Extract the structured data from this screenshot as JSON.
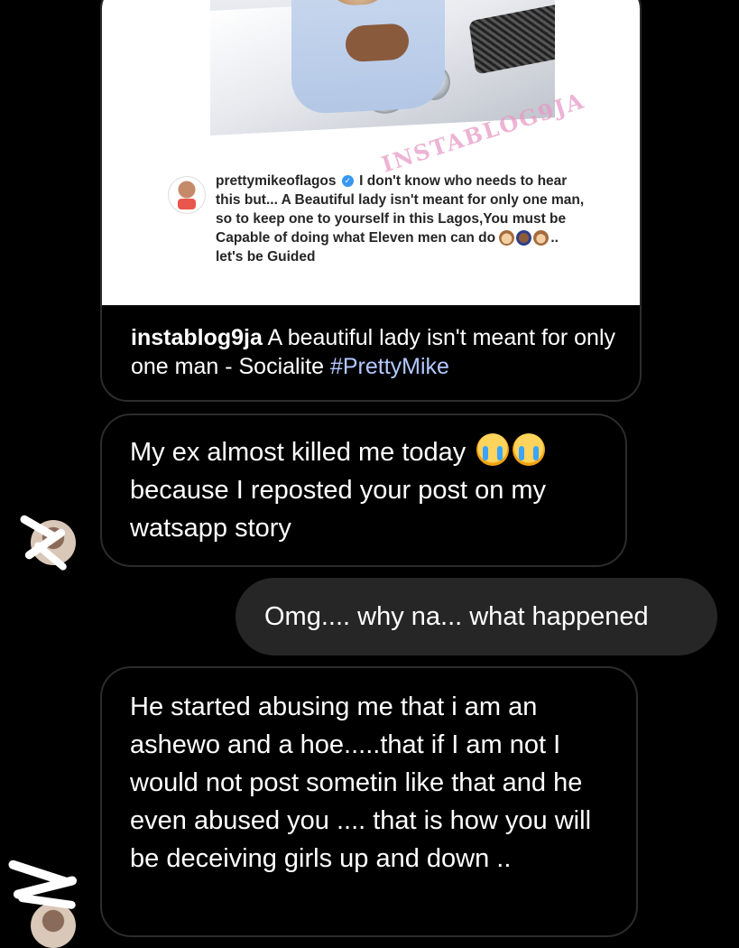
{
  "post": {
    "watermark": "INSTABLOG9JA",
    "caption_username": "prettymikeoflagos",
    "caption_text": "I don't know who needs to hear this but... A Beautiful lady isn't meant for only one man, so to keep one to yourself in this Lagos,You must be Capable of doing what Eleven men can do",
    "caption_tail": "..",
    "caption_end": "let's be Guided",
    "footer_account": "instablog9ja",
    "footer_text": "A beautiful lady isn't meant for only one man - Socialite",
    "footer_hashtag": "#PrettyMike"
  },
  "messages": [
    {
      "direction": "incoming",
      "text": "My ex almost killed me today",
      "emoji": [
        "loudly-crying-face",
        "loudly-crying-face"
      ],
      "text_after": "because I reposted your post on my watsapp story"
    },
    {
      "direction": "outgoing",
      "text": "Omg.... why na... what happened"
    },
    {
      "direction": "incoming",
      "text": "He started abusing me that i am an ashewo and a hoe.....that if I am not I would not post sometin like that and he even abused you .... that is how you will be deceiving girls up and down .."
    }
  ],
  "colors": {
    "background": "#000000",
    "outgoing_bubble": "#262626",
    "incoming_border": "#2c2c2c",
    "hashtag": "#b2c8ff",
    "watermark": "#e89ac6",
    "verified": "#3897f0"
  }
}
